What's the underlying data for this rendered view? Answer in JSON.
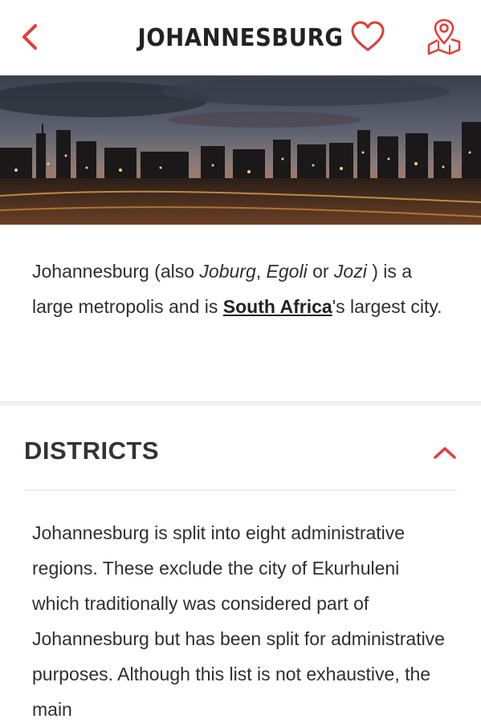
{
  "header": {
    "title": "JOHANNESBURG",
    "back_icon": "chevron-left-icon",
    "favorite_icon": "heart-icon",
    "map_icon": "map-pin-icon",
    "accent_color": "#e53935"
  },
  "hero": {
    "alt": "Johannesburg city skyline at dusk"
  },
  "intro": {
    "p1": "Johannesburg (also ",
    "alias1": "Joburg",
    "sep1": ", ",
    "alias2": "Egoli",
    "sep2": " or ",
    "alias3": "Jozi",
    "p2": " ) is a large metropolis and is ",
    "link": "South Africa",
    "p3": "'s largest city."
  },
  "districts": {
    "title": "DISTRICTS",
    "toggle_icon": "chevron-up-icon",
    "body": "Johannesburg is split into eight administrative regions. These exclude the city of Ekurhuleni which traditionally was considered part of Johannesburg but has been split for administrative purposes. Although this list is not exhaustive, the main"
  }
}
